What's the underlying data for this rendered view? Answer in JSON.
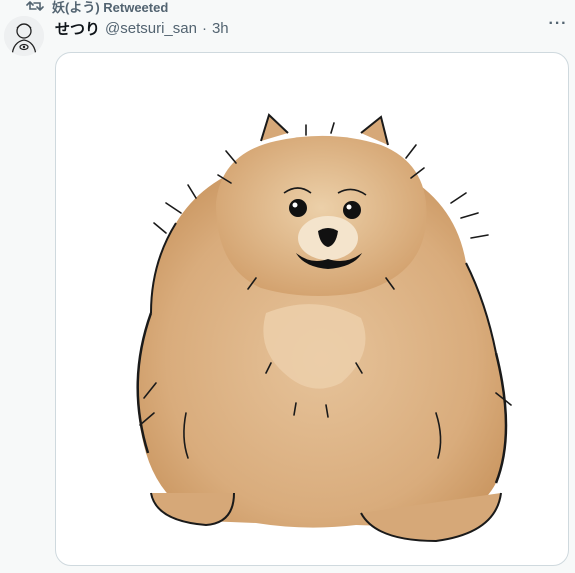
{
  "retweet": {
    "icon": "retweet-icon",
    "label": "妖(よう) Retweeted"
  },
  "tweet": {
    "avatar_icon": "user-avatar-icon",
    "display_name": "せつり",
    "handle": "@setsuri_san",
    "separator": "·",
    "time": "3h",
    "more_label": "···",
    "media_description_icon": "pomeranian-illustration"
  },
  "colors": {
    "background": "#f7f9f9",
    "text_primary": "#0f1419",
    "text_secondary": "#536471",
    "media_border": "#cfd9de"
  }
}
